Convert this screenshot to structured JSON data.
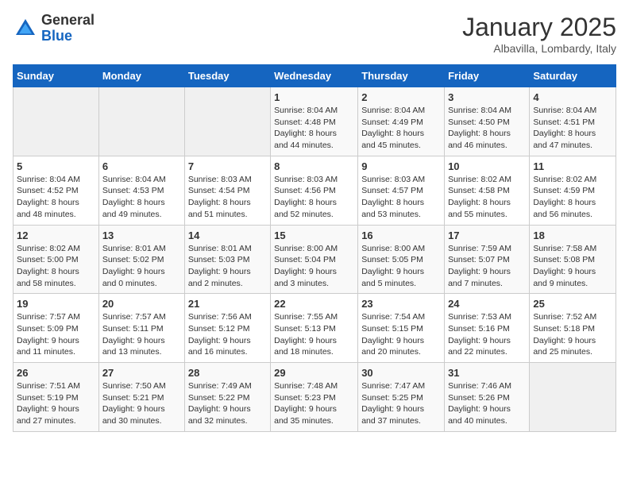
{
  "logo": {
    "general": "General",
    "blue": "Blue"
  },
  "title": "January 2025",
  "location": "Albavilla, Lombardy, Italy",
  "weekdays": [
    "Sunday",
    "Monday",
    "Tuesday",
    "Wednesday",
    "Thursday",
    "Friday",
    "Saturday"
  ],
  "weeks": [
    [
      {
        "day": "",
        "info": ""
      },
      {
        "day": "",
        "info": ""
      },
      {
        "day": "",
        "info": ""
      },
      {
        "day": "1",
        "info": "Sunrise: 8:04 AM\nSunset: 4:48 PM\nDaylight: 8 hours\nand 44 minutes."
      },
      {
        "day": "2",
        "info": "Sunrise: 8:04 AM\nSunset: 4:49 PM\nDaylight: 8 hours\nand 45 minutes."
      },
      {
        "day": "3",
        "info": "Sunrise: 8:04 AM\nSunset: 4:50 PM\nDaylight: 8 hours\nand 46 minutes."
      },
      {
        "day": "4",
        "info": "Sunrise: 8:04 AM\nSunset: 4:51 PM\nDaylight: 8 hours\nand 47 minutes."
      }
    ],
    [
      {
        "day": "5",
        "info": "Sunrise: 8:04 AM\nSunset: 4:52 PM\nDaylight: 8 hours\nand 48 minutes."
      },
      {
        "day": "6",
        "info": "Sunrise: 8:04 AM\nSunset: 4:53 PM\nDaylight: 8 hours\nand 49 minutes."
      },
      {
        "day": "7",
        "info": "Sunrise: 8:03 AM\nSunset: 4:54 PM\nDaylight: 8 hours\nand 51 minutes."
      },
      {
        "day": "8",
        "info": "Sunrise: 8:03 AM\nSunset: 4:56 PM\nDaylight: 8 hours\nand 52 minutes."
      },
      {
        "day": "9",
        "info": "Sunrise: 8:03 AM\nSunset: 4:57 PM\nDaylight: 8 hours\nand 53 minutes."
      },
      {
        "day": "10",
        "info": "Sunrise: 8:02 AM\nSunset: 4:58 PM\nDaylight: 8 hours\nand 55 minutes."
      },
      {
        "day": "11",
        "info": "Sunrise: 8:02 AM\nSunset: 4:59 PM\nDaylight: 8 hours\nand 56 minutes."
      }
    ],
    [
      {
        "day": "12",
        "info": "Sunrise: 8:02 AM\nSunset: 5:00 PM\nDaylight: 8 hours\nand 58 minutes."
      },
      {
        "day": "13",
        "info": "Sunrise: 8:01 AM\nSunset: 5:02 PM\nDaylight: 9 hours\nand 0 minutes."
      },
      {
        "day": "14",
        "info": "Sunrise: 8:01 AM\nSunset: 5:03 PM\nDaylight: 9 hours\nand 2 minutes."
      },
      {
        "day": "15",
        "info": "Sunrise: 8:00 AM\nSunset: 5:04 PM\nDaylight: 9 hours\nand 3 minutes."
      },
      {
        "day": "16",
        "info": "Sunrise: 8:00 AM\nSunset: 5:05 PM\nDaylight: 9 hours\nand 5 minutes."
      },
      {
        "day": "17",
        "info": "Sunrise: 7:59 AM\nSunset: 5:07 PM\nDaylight: 9 hours\nand 7 minutes."
      },
      {
        "day": "18",
        "info": "Sunrise: 7:58 AM\nSunset: 5:08 PM\nDaylight: 9 hours\nand 9 minutes."
      }
    ],
    [
      {
        "day": "19",
        "info": "Sunrise: 7:57 AM\nSunset: 5:09 PM\nDaylight: 9 hours\nand 11 minutes."
      },
      {
        "day": "20",
        "info": "Sunrise: 7:57 AM\nSunset: 5:11 PM\nDaylight: 9 hours\nand 13 minutes."
      },
      {
        "day": "21",
        "info": "Sunrise: 7:56 AM\nSunset: 5:12 PM\nDaylight: 9 hours\nand 16 minutes."
      },
      {
        "day": "22",
        "info": "Sunrise: 7:55 AM\nSunset: 5:13 PM\nDaylight: 9 hours\nand 18 minutes."
      },
      {
        "day": "23",
        "info": "Sunrise: 7:54 AM\nSunset: 5:15 PM\nDaylight: 9 hours\nand 20 minutes."
      },
      {
        "day": "24",
        "info": "Sunrise: 7:53 AM\nSunset: 5:16 PM\nDaylight: 9 hours\nand 22 minutes."
      },
      {
        "day": "25",
        "info": "Sunrise: 7:52 AM\nSunset: 5:18 PM\nDaylight: 9 hours\nand 25 minutes."
      }
    ],
    [
      {
        "day": "26",
        "info": "Sunrise: 7:51 AM\nSunset: 5:19 PM\nDaylight: 9 hours\nand 27 minutes."
      },
      {
        "day": "27",
        "info": "Sunrise: 7:50 AM\nSunset: 5:21 PM\nDaylight: 9 hours\nand 30 minutes."
      },
      {
        "day": "28",
        "info": "Sunrise: 7:49 AM\nSunset: 5:22 PM\nDaylight: 9 hours\nand 32 minutes."
      },
      {
        "day": "29",
        "info": "Sunrise: 7:48 AM\nSunset: 5:23 PM\nDaylight: 9 hours\nand 35 minutes."
      },
      {
        "day": "30",
        "info": "Sunrise: 7:47 AM\nSunset: 5:25 PM\nDaylight: 9 hours\nand 37 minutes."
      },
      {
        "day": "31",
        "info": "Sunrise: 7:46 AM\nSunset: 5:26 PM\nDaylight: 9 hours\nand 40 minutes."
      },
      {
        "day": "",
        "info": ""
      }
    ]
  ]
}
